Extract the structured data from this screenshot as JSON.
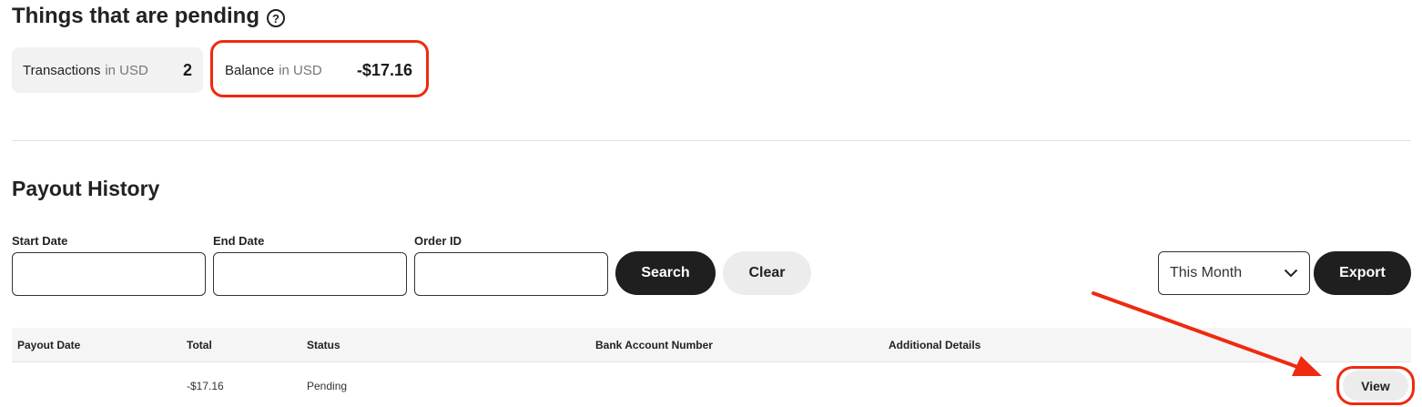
{
  "pending": {
    "title": "Things that are pending",
    "help_icon": "question-circle-icon",
    "transactions": {
      "label": "Transactions",
      "unit": "in USD",
      "value": "2"
    },
    "balance": {
      "label": "Balance",
      "unit": "in USD",
      "value": "-$17.16"
    }
  },
  "payout_history": {
    "title": "Payout History",
    "filters": {
      "start_date_label": "Start Date",
      "start_date_value": "",
      "end_date_label": "End Date",
      "end_date_value": "",
      "order_id_label": "Order ID",
      "order_id_value": ""
    },
    "search_label": "Search",
    "clear_label": "Clear",
    "period_select": "This Month",
    "export_label": "Export",
    "table": {
      "columns": [
        "Payout Date",
        "Total",
        "Status",
        "Bank Account Number",
        "Additional Details"
      ],
      "rows": [
        {
          "payout_date": "",
          "total": "-$17.16",
          "status": "Pending",
          "bank_account_number": "",
          "additional_details": "",
          "action": "View"
        }
      ]
    }
  },
  "annotations": {
    "highlight_color": "#ee2a10"
  }
}
